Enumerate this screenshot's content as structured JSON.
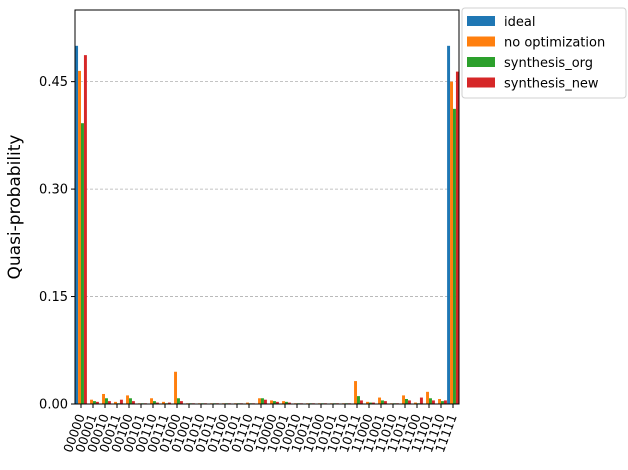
{
  "chart_data": {
    "type": "bar",
    "ylabel": "Quasi-probability",
    "xlabel": "",
    "title": "",
    "ylim": [
      0,
      0.55
    ],
    "yticks": [
      0.0,
      0.15,
      0.3,
      0.45
    ],
    "ytick_labels": [
      "0.00",
      "0.15",
      "0.30",
      "0.45"
    ],
    "grid": "horizontal-dashed",
    "legend_position": "outside-top-right",
    "categories": [
      "00000",
      "00001",
      "00010",
      "00011",
      "00100",
      "00101",
      "00110",
      "00111",
      "01000",
      "01001",
      "01010",
      "01011",
      "01100",
      "01101",
      "01110",
      "01111",
      "10000",
      "10001",
      "10010",
      "10011",
      "10100",
      "10101",
      "10110",
      "10111",
      "11000",
      "11001",
      "11010",
      "11011",
      "11100",
      "11101",
      "11110",
      "11111"
    ],
    "series": [
      {
        "name": "ideal",
        "color": "#1f77b4",
        "values": [
          0.5,
          0,
          0,
          0,
          0,
          0,
          0,
          0,
          0,
          0,
          0,
          0,
          0,
          0,
          0,
          0,
          0,
          0,
          0,
          0,
          0,
          0,
          0,
          0,
          0,
          0,
          0,
          0,
          0,
          0,
          0,
          0.5
        ]
      },
      {
        "name": "no optimization",
        "color": "#ff7f0e",
        "values": [
          0.465,
          0.006,
          0.014,
          0.003,
          0.012,
          0.001,
          0.008,
          0.003,
          0.045,
          0.001,
          0.001,
          0.001,
          0.001,
          0.001,
          0.002,
          0.008,
          0.005,
          0.004,
          0.001,
          0.001,
          0.001,
          0.001,
          0.001,
          0.032,
          0.003,
          0.009,
          0.001,
          0.012,
          0.002,
          0.017,
          0.007,
          0.45
        ]
      },
      {
        "name": "synthesis_org",
        "color": "#2ca02c",
        "values": [
          0.392,
          0.004,
          0.008,
          0.001,
          0.008,
          0.001,
          0.004,
          0.001,
          0.008,
          0.001,
          0.001,
          0.001,
          0.001,
          0.001,
          0.001,
          0.008,
          0.004,
          0.003,
          0.001,
          0.001,
          0.001,
          0.001,
          0.001,
          0.011,
          0.002,
          0.005,
          0.001,
          0.007,
          0.001,
          0.008,
          0.004,
          0.412
        ]
      },
      {
        "name": "synthesis_new",
        "color": "#d62728",
        "values": [
          0.487,
          0.003,
          0.004,
          0.006,
          0.004,
          0.001,
          0.002,
          0.002,
          0.004,
          0.001,
          0.001,
          0.001,
          0.001,
          0.001,
          0.001,
          0.006,
          0.003,
          0.002,
          0.001,
          0.001,
          0.001,
          0.001,
          0.001,
          0.005,
          0.002,
          0.004,
          0.001,
          0.005,
          0.009,
          0.005,
          0.005,
          0.464
        ]
      }
    ]
  }
}
